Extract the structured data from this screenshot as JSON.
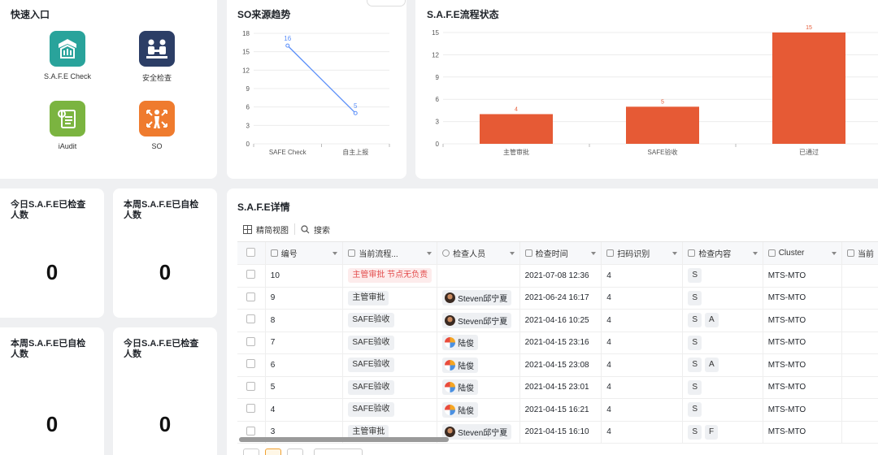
{
  "quick_access": {
    "title": "快速入口",
    "items": [
      {
        "label": "S.A.F.E Check",
        "icon": "safe-check-icon",
        "color": "#29a39b"
      },
      {
        "label": "安全检查",
        "icon": "safety-inspection-icon",
        "color": "#2c3e66"
      },
      {
        "label": "iAudit",
        "icon": "clipboard-audit-icon",
        "color": "#7bb440"
      },
      {
        "label": "SO",
        "icon": "person-arrows-icon",
        "color": "#ef7b2e"
      }
    ]
  },
  "stats": [
    {
      "title": "今日S.A.F.E已检查人数",
      "value": "0"
    },
    {
      "title": "本周S.A.F.E已自检人数",
      "value": "0"
    },
    {
      "title": "本周S.A.F.E已自检人数",
      "value": "0"
    },
    {
      "title": "今日S.A.F.E已检查人数",
      "value": "0"
    }
  ],
  "charts": {
    "colors": {
      "line": "#5b8ff9",
      "bar": "#e65a35"
    },
    "so_trend": {
      "title": "SO来源趋势",
      "chart_data": {
        "type": "line",
        "categories": [
          "SAFE Check",
          "自主上报"
        ],
        "values": [
          16,
          5
        ],
        "yticks": [
          "0",
          "3",
          "6",
          "9",
          "12",
          "15",
          "18"
        ],
        "ylim": [
          0,
          18
        ]
      }
    },
    "safe_flow": {
      "title": "S.A.F.E流程状态",
      "chart_data": {
        "type": "bar",
        "categories": [
          "主管审批",
          "SAFE验收",
          "已通过"
        ],
        "values": [
          4,
          5,
          15
        ],
        "yticks": [
          "0",
          "3",
          "6",
          "9",
          "12",
          "15"
        ],
        "ylim": [
          0,
          15
        ]
      }
    }
  },
  "details": {
    "title": "S.A.F.E详情",
    "toolbar": {
      "view_label": "精简视图",
      "search_label": "搜索"
    },
    "columns": [
      "编号",
      "当前流程...",
      "检查人员",
      "检查时间",
      "扫码识别",
      "检查内容",
      "Cluster",
      "当前"
    ],
    "rows": [
      {
        "id": "10",
        "status": "主管审批",
        "status_note": "节点无负责",
        "status_red": true,
        "inspector": "",
        "avatar": "",
        "time": "2021-07-08 12:36",
        "scan": "4",
        "content": [
          "S"
        ],
        "cluster": "MTS-MTO"
      },
      {
        "id": "9",
        "status": "主管审批",
        "status_note": "",
        "status_red": false,
        "inspector": "Steven邱宁夏",
        "avatar": "steven",
        "time": "2021-06-24 16:17",
        "scan": "4",
        "content": [
          "S"
        ],
        "cluster": "MTS-MTO"
      },
      {
        "id": "8",
        "status": "SAFE验收",
        "status_note": "",
        "status_red": false,
        "inspector": "Steven邱宁夏",
        "avatar": "steven",
        "time": "2021-04-16 10:25",
        "scan": "4",
        "content": [
          "S",
          "A"
        ],
        "cluster": "MTS-MTO"
      },
      {
        "id": "7",
        "status": "SAFE验收",
        "status_note": "",
        "status_red": false,
        "inspector": "陆俊",
        "avatar": "lu",
        "time": "2021-04-15 23:16",
        "scan": "4",
        "content": [
          "S"
        ],
        "cluster": "MTS-MTO"
      },
      {
        "id": "6",
        "status": "SAFE验收",
        "status_note": "",
        "status_red": false,
        "inspector": "陆俊",
        "avatar": "lu",
        "time": "2021-04-15 23:08",
        "scan": "4",
        "content": [
          "S",
          "A"
        ],
        "cluster": "MTS-MTO"
      },
      {
        "id": "5",
        "status": "SAFE验收",
        "status_note": "",
        "status_red": false,
        "inspector": "陆俊",
        "avatar": "lu",
        "time": "2021-04-15 23:01",
        "scan": "4",
        "content": [
          "S"
        ],
        "cluster": "MTS-MTO"
      },
      {
        "id": "4",
        "status": "SAFE验收",
        "status_note": "",
        "status_red": false,
        "inspector": "陆俊",
        "avatar": "lu",
        "time": "2021-04-15 16:21",
        "scan": "4",
        "content": [
          "S"
        ],
        "cluster": "MTS-MTO"
      },
      {
        "id": "3",
        "status": "主管审批",
        "status_note": "",
        "status_red": false,
        "inspector": "Steven邱宁夏",
        "avatar": "steven",
        "time": "2021-04-15 16:10",
        "scan": "4",
        "content": [
          "S",
          "F"
        ],
        "cluster": "MTS-MTO"
      }
    ]
  }
}
